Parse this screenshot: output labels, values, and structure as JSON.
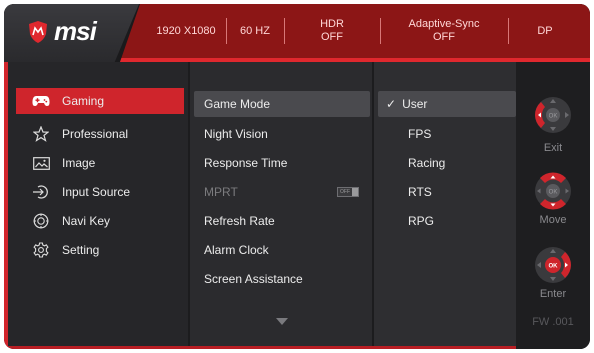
{
  "header": {
    "brand": "msi",
    "info": [
      {
        "line1": "1920 X1080",
        "line2": ""
      },
      {
        "line1": "60 HZ",
        "line2": ""
      },
      {
        "line1": "HDR",
        "line2": "OFF"
      },
      {
        "line1": "Adaptive-Sync",
        "line2": "OFF"
      },
      {
        "line1": "DP",
        "line2": ""
      }
    ]
  },
  "main_menu": {
    "items": [
      {
        "label": "Gaming",
        "icon": "gamepad-icon",
        "selected": true
      },
      {
        "label": "Professional",
        "icon": "star-icon",
        "selected": false
      },
      {
        "label": "Image",
        "icon": "image-icon",
        "selected": false
      },
      {
        "label": "Input Source",
        "icon": "input-source-icon",
        "selected": false
      },
      {
        "label": "Navi Key",
        "icon": "navi-key-icon",
        "selected": false
      },
      {
        "label": "Setting",
        "icon": "gear-icon",
        "selected": false
      }
    ]
  },
  "sub_menu": {
    "items": [
      {
        "label": "Game Mode",
        "selected": true,
        "enabled": true
      },
      {
        "label": "Night Vision",
        "selected": false,
        "enabled": true
      },
      {
        "label": "Response Time",
        "selected": false,
        "enabled": true
      },
      {
        "label": "MPRT",
        "selected": false,
        "enabled": false,
        "toggle": "OFF"
      },
      {
        "label": "Refresh Rate",
        "selected": false,
        "enabled": true
      },
      {
        "label": "Alarm Clock",
        "selected": false,
        "enabled": true
      },
      {
        "label": "Screen Assistance",
        "selected": false,
        "enabled": true
      }
    ]
  },
  "options": {
    "items": [
      {
        "label": "User",
        "selected": true,
        "checkmark": "✓"
      },
      {
        "label": "FPS",
        "selected": false
      },
      {
        "label": "Racing",
        "selected": false
      },
      {
        "label": "RTS",
        "selected": false
      },
      {
        "label": "RPG",
        "selected": false
      }
    ]
  },
  "navigation": {
    "exit_label": "Exit",
    "move_label": "Move",
    "enter_label": "Enter",
    "ok_text": "OK",
    "firmware": "FW .001"
  },
  "colors": {
    "accent_red": "#cf252c",
    "header_red": "#8c1616",
    "panel_dark": "#1c1c1e"
  }
}
